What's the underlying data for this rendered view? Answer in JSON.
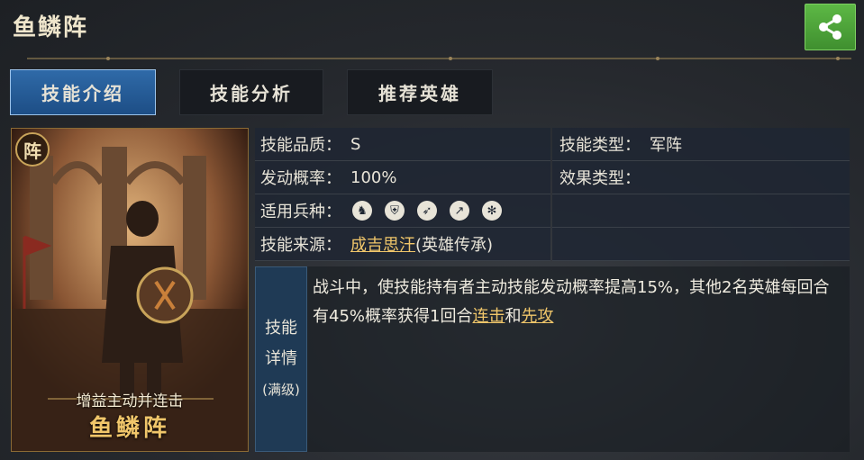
{
  "header": {
    "title": "鱼鳞阵",
    "share_icon": "share-icon"
  },
  "tabs": [
    {
      "label": "技能介绍",
      "active": true
    },
    {
      "label": "技能分析",
      "active": false
    },
    {
      "label": "推荐英雄",
      "active": false
    }
  ],
  "card": {
    "badge": "阵",
    "subtitle": "增益主动并连击",
    "name": "鱼鳞阵"
  },
  "info": {
    "quality_label": "技能品质：",
    "quality_value": "S",
    "type_label": "技能类型：",
    "type_value": "军阵",
    "rate_label": "发动概率：",
    "rate_value": "100%",
    "effect_label": "效果类型：",
    "effect_value": "",
    "troops_label": "适用兵种：",
    "troops": [
      "horse-icon",
      "shield-icon",
      "bow-icon",
      "spear-icon",
      "wheel-icon"
    ],
    "source_label": "技能来源：",
    "source_link": "成吉思汗",
    "source_suffix": "(英雄传承)"
  },
  "detail": {
    "label_line1": "技能",
    "label_line2": "详情",
    "label_line3": "(满级)",
    "text_part1": "战斗中，使技能持有者主动技能发动概率提高15%，其他2名英雄每回合有45%概率获得1回合",
    "link1": "连击",
    "text_part2": "和",
    "link2": "先攻"
  },
  "colors": {
    "accent_blue": "#2f6aa8",
    "gold": "#f0c66a",
    "share_green": "#4fa83b"
  }
}
